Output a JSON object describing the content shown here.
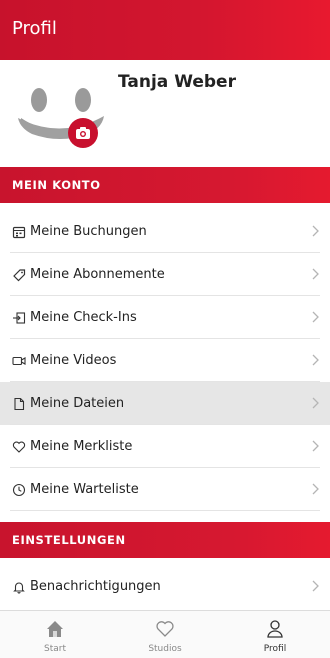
{
  "header": {
    "title": "Profil"
  },
  "profile": {
    "name": "Tanja Weber"
  },
  "sections": {
    "account": "MEIN KONTO",
    "settings": "EINSTELLUNGEN"
  },
  "account_items": [
    {
      "label": "Meine Buchungen",
      "icon": "calendar-icon"
    },
    {
      "label": "Meine Abonnemente",
      "icon": "tag-icon"
    },
    {
      "label": "Meine Check-Ins",
      "icon": "check-in-icon"
    },
    {
      "label": "Meine Videos",
      "icon": "video-icon"
    },
    {
      "label": "Meine Dateien",
      "icon": "file-icon"
    },
    {
      "label": "Meine Merkliste",
      "icon": "heart-icon"
    },
    {
      "label": "Meine Warteliste",
      "icon": "clock-icon"
    }
  ],
  "settings_items": [
    {
      "label": "Benachrichtigungen",
      "icon": "bell-icon"
    }
  ],
  "tabs": [
    {
      "label": "Start",
      "icon": "home-icon"
    },
    {
      "label": "Studios",
      "icon": "heart-icon"
    },
    {
      "label": "Profil",
      "icon": "user-icon"
    }
  ],
  "colors": {
    "brand_red": "#d3162f",
    "selected_row": "#e6e6e6"
  }
}
